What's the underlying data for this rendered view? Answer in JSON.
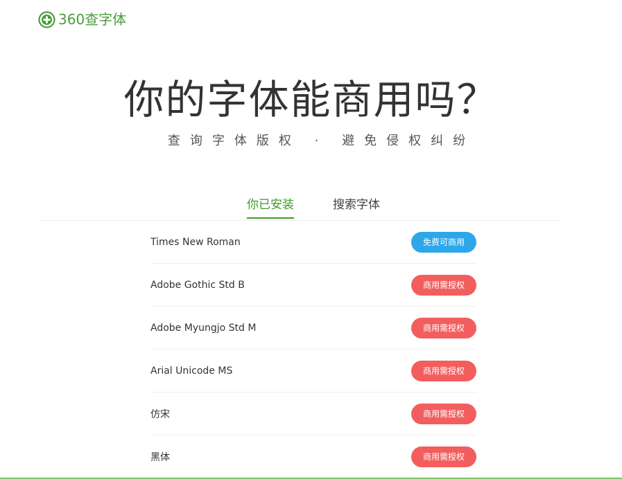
{
  "brand": {
    "logo_text": "360查字体",
    "color": "#4a9d3c"
  },
  "hero": {
    "title": "你的字体能商用吗？",
    "subtitle": "查询字体版权 · 避免侵权纠纷"
  },
  "tabs": [
    {
      "label": "你已安装",
      "active": true
    },
    {
      "label": "搜索字体",
      "active": false
    }
  ],
  "fonts": [
    {
      "name": "Times New Roman",
      "status": "免费可商用",
      "status_type": "free"
    },
    {
      "name": "Adobe Gothic Std B",
      "status": "商用需授权",
      "status_type": "paid"
    },
    {
      "name": "Adobe Myungjo Std M",
      "status": "商用需授权",
      "status_type": "paid"
    },
    {
      "name": "Arial Unicode MS",
      "status": "商用需授权",
      "status_type": "paid"
    },
    {
      "name": "仿宋",
      "status": "商用需授权",
      "status_type": "paid"
    },
    {
      "name": "黑体",
      "status": "商用需授权",
      "status_type": "paid"
    }
  ],
  "colors": {
    "accent": "#3f9a2c",
    "free_badge": "#2ea7ea",
    "paid_badge": "#f25e5e"
  }
}
